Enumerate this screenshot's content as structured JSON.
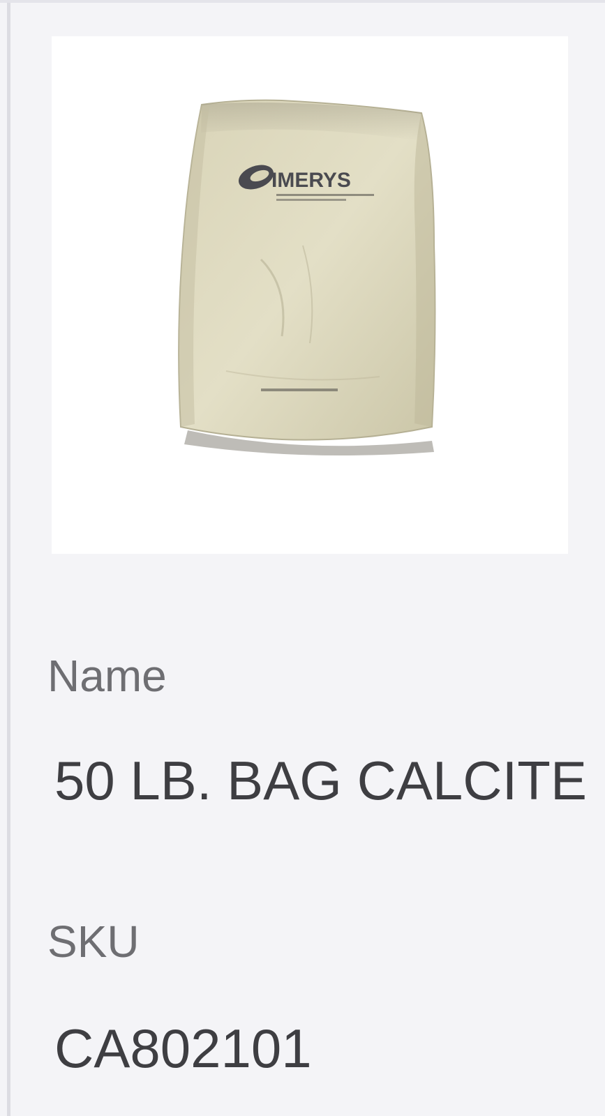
{
  "product": {
    "image": {
      "icon": "product-bag-image",
      "logo_text": "IMERYS",
      "bag_color": "#d8d3b7",
      "logo_color": "#4a4a50"
    },
    "name_label": "Name",
    "name_value": "50 LB. BAG CALCITE",
    "sku_label": "SKU",
    "sku_value": "CA802101"
  },
  "colors": {
    "background": "#f4f4f7",
    "label_text": "#6e6e72",
    "value_text": "#3e3e42"
  }
}
